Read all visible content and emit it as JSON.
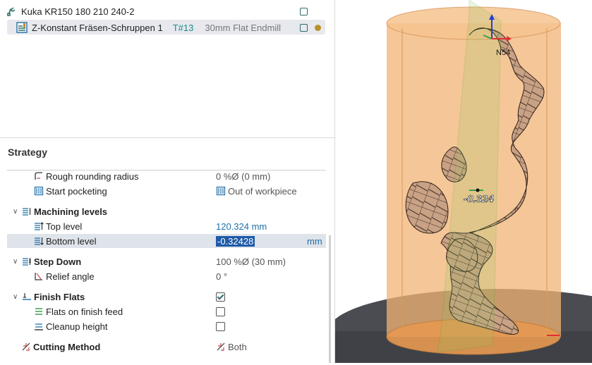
{
  "tree": {
    "machine_label": "Kuka KR150 180 210 240-2",
    "operation_label": "Z-Konstant Fräsen-Schruppen 1",
    "operation_tool": "T#13",
    "operation_tool_desc": "30mm Flat Endmill"
  },
  "strategy": {
    "title": "Strategy",
    "rows": [
      {
        "label": "Rough rounding radius",
        "value": "0 %Ø (0 mm)"
      },
      {
        "label": "Start pocketing",
        "value": "Out of workpiece"
      },
      {
        "label": "Machining levels",
        "value": ""
      },
      {
        "label": "Top level",
        "value": "120.324 mm"
      },
      {
        "label": "Bottom level",
        "value": "-0.32428",
        "unit": "mm"
      },
      {
        "label": "Step Down",
        "value": "100 %Ø (30 mm)"
      },
      {
        "label": "Relief angle",
        "value": "0 °"
      },
      {
        "label": "Finish Flats",
        "checked": true
      },
      {
        "label": "Flats on finish feed",
        "checked": false
      },
      {
        "label": "Cleanup height",
        "checked": false
      },
      {
        "label": "Cutting Method",
        "value": "Both"
      }
    ]
  },
  "viewport": {
    "point_label": "N54",
    "level_label": "-0.324"
  }
}
